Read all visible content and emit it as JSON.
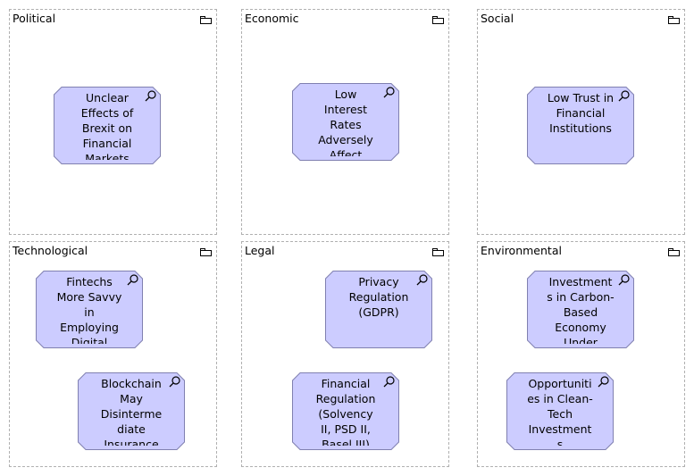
{
  "groups": [
    {
      "label": "Political"
    },
    {
      "label": "Economic"
    },
    {
      "label": "Social"
    },
    {
      "label": "Technological"
    },
    {
      "label": "Legal"
    },
    {
      "label": "Environmental"
    }
  ],
  "elements": [
    {
      "text": "Unclear\nEffects of\nBrexit on\nFinancial\nMarkets"
    },
    {
      "text": "Low\nInterest\nRates\nAdversely\nAffect"
    },
    {
      "text": "Low Trust in\nFinancial\nInstitutions"
    },
    {
      "text": "Fintechs\nMore Savvy\nin\nEmploying\nDigital"
    },
    {
      "text": "Blockchain\nMay\nDisinterme\ndiate\nInsurance"
    },
    {
      "text": "Privacy\nRegulation\n(GDPR)"
    },
    {
      "text": "Financial\nRegulation\n(Solvency\nII, PSD II,\nBasel III)"
    },
    {
      "text": "Investment\ns in Carbon-\nBased\nEconomy\nUnder"
    },
    {
      "text": "Opportuniti\nes in Clean-\nTech\nInvestment\ns"
    }
  ],
  "colors": {
    "element_fill": "#ccccff",
    "element_border": "#8080b0",
    "group_border": "#b0b0b0"
  },
  "icons": {
    "group": "folder-icon",
    "element": "magnifier-icon"
  }
}
